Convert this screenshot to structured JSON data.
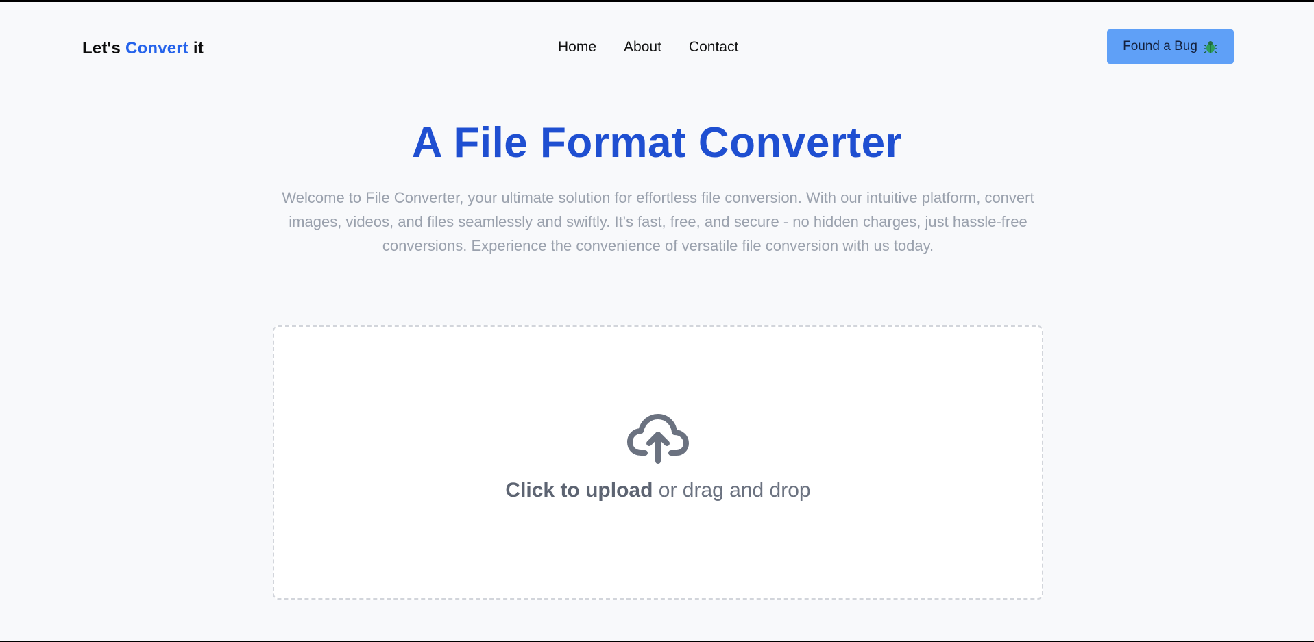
{
  "navbar": {
    "brand": {
      "prefix": "Let's ",
      "accent": "Convert",
      "suffix": " it"
    },
    "links": [
      "Home",
      "About",
      "Contact"
    ],
    "bug_button": {
      "label": "Found a Bug",
      "icon": "bug-icon"
    }
  },
  "hero": {
    "title": "A File Format Converter",
    "description": "Welcome to File Converter, your ultimate solution for effortless file conversion. With our intuitive platform, convert images, videos, and files seamlessly and swiftly. It's fast, free, and secure - no hidden charges, just hassle-free conversions. Experience the convenience of versatile file conversion with us today."
  },
  "dropzone": {
    "icon": "cloud-upload-icon",
    "cta": "Click to upload",
    "rest": " or drag and drop"
  },
  "colors": {
    "accent": "#2563eb",
    "title": "#1f4fd1",
    "button": "#5fa0f7",
    "background": "#f8f9fb",
    "muted_text": "#9aa1ad",
    "upload_text": "#6b7280"
  }
}
